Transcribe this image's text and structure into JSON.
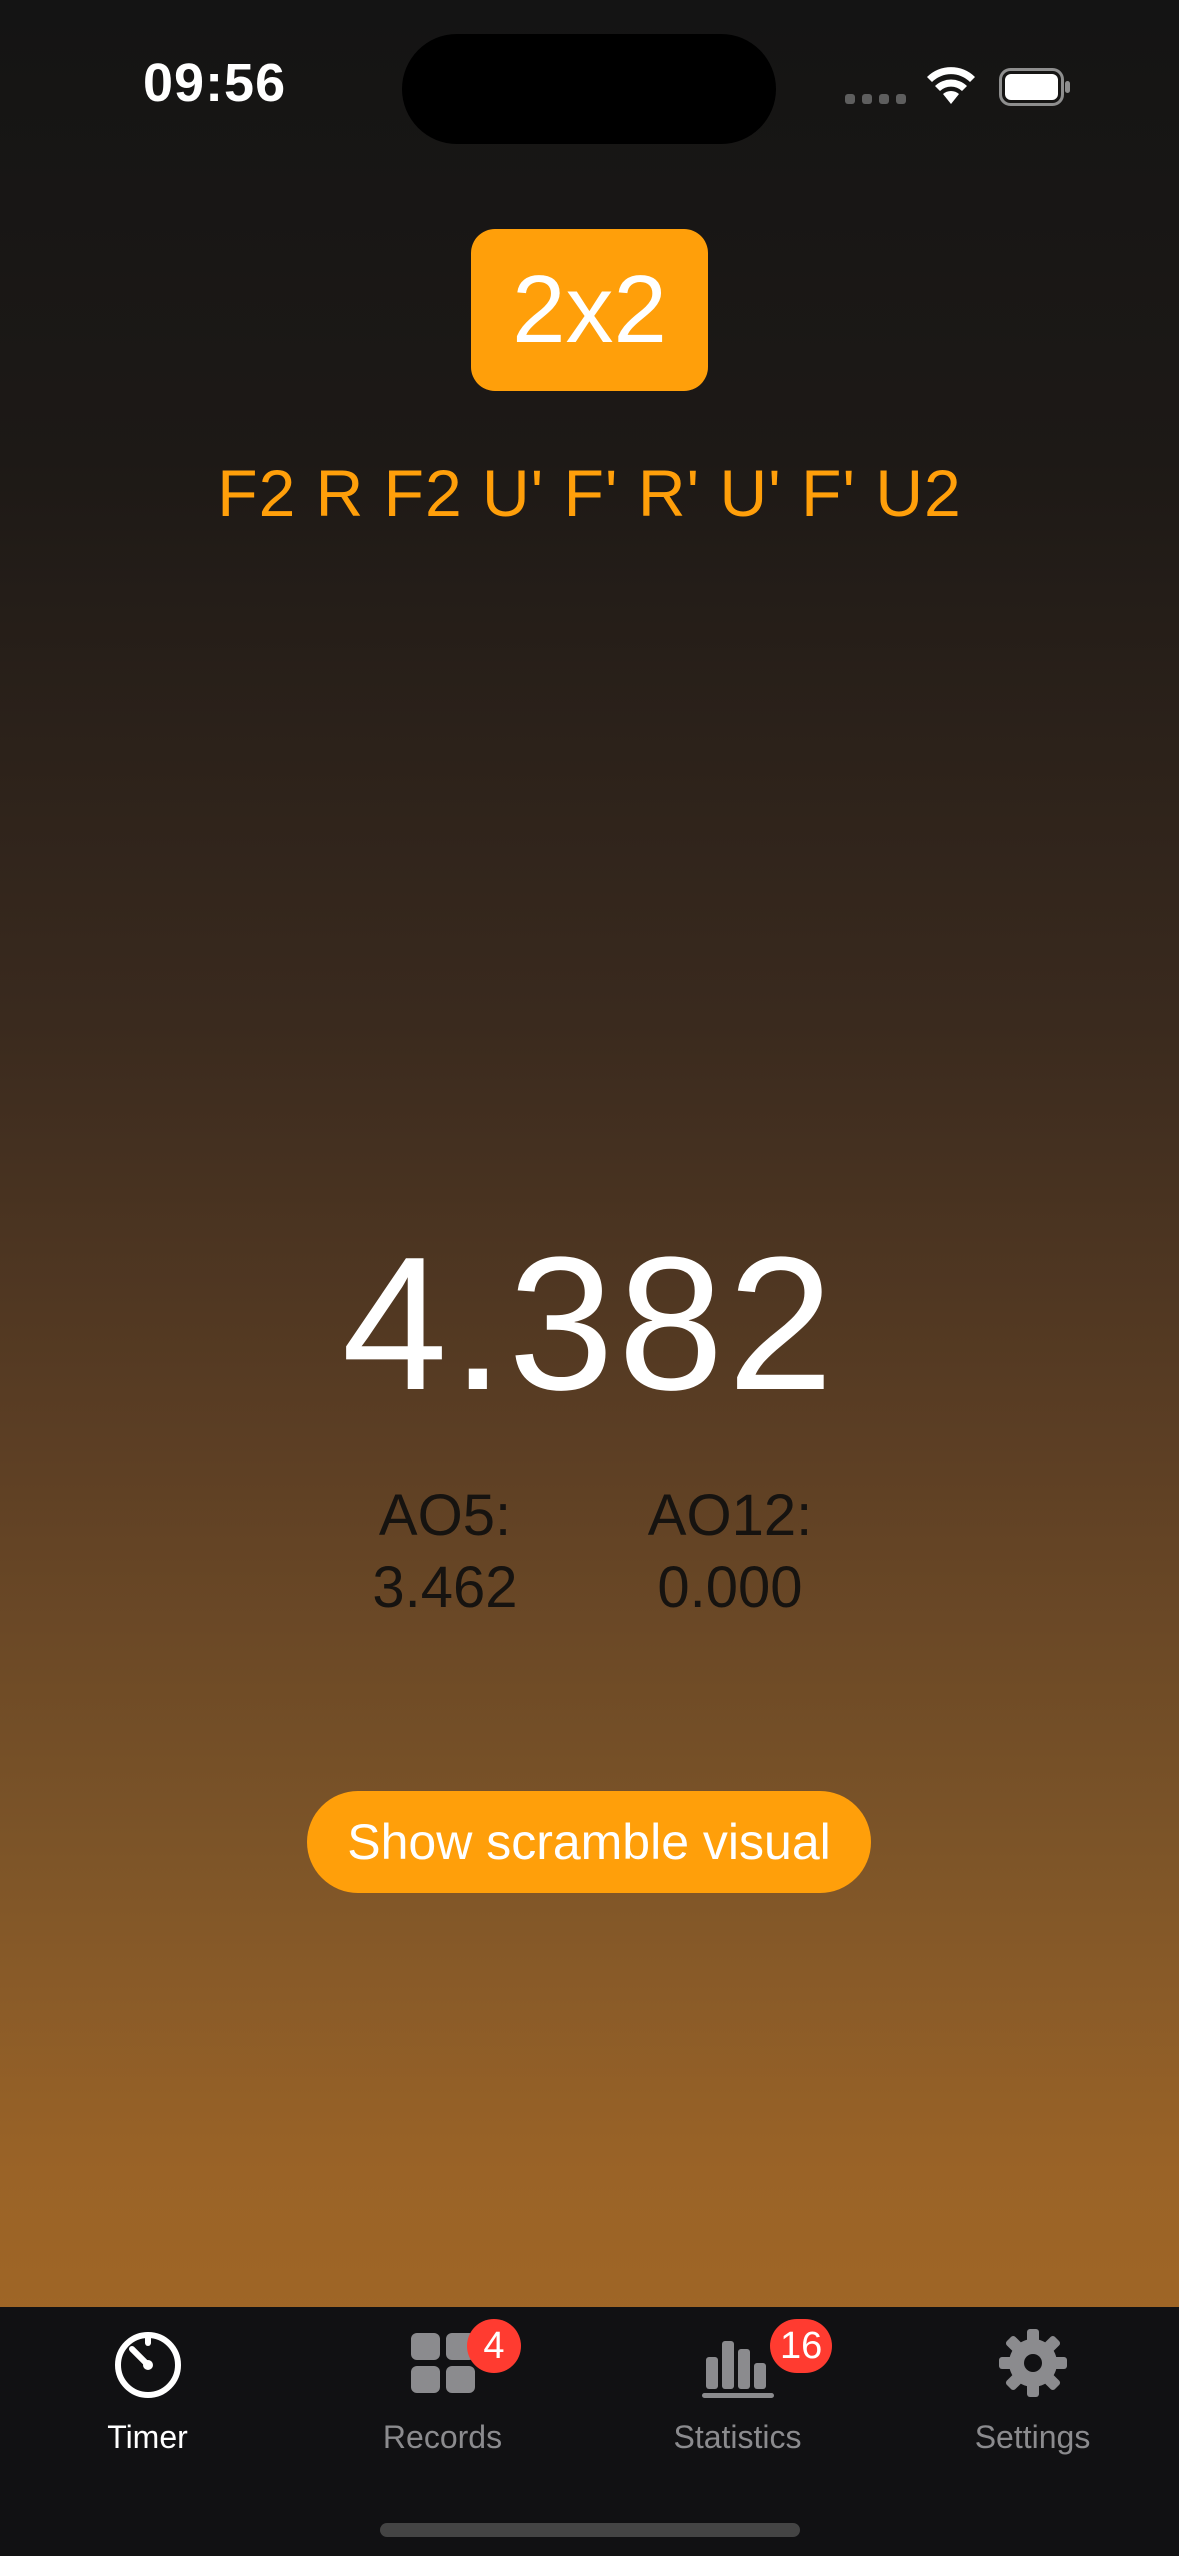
{
  "status_bar": {
    "time": "09:56"
  },
  "puzzle": {
    "label": "2x2"
  },
  "scramble": {
    "text": "F2 R F2 U' F' R' U' F' U2"
  },
  "timer": {
    "value": "4.382"
  },
  "averages": {
    "ao5_label": "AO5:",
    "ao5_value": "3.462",
    "ao12_label": "AO12:",
    "ao12_value": "0.000"
  },
  "show_visual_button": {
    "label": "Show scramble visual"
  },
  "tabbar": {
    "active": "Timer",
    "tabs": [
      {
        "label": "Timer",
        "icon": "stopwatch-icon",
        "badge": null
      },
      {
        "label": "Records",
        "icon": "grid-icon",
        "badge": "4"
      },
      {
        "label": "Statistics",
        "icon": "bar-chart-icon",
        "badge": "16"
      },
      {
        "label": "Settings",
        "icon": "gear-icon",
        "badge": null
      }
    ]
  },
  "colors": {
    "accent": "#ff9f0a",
    "badge": "#ff3b30",
    "tab_inactive": "#8b8b8e"
  }
}
